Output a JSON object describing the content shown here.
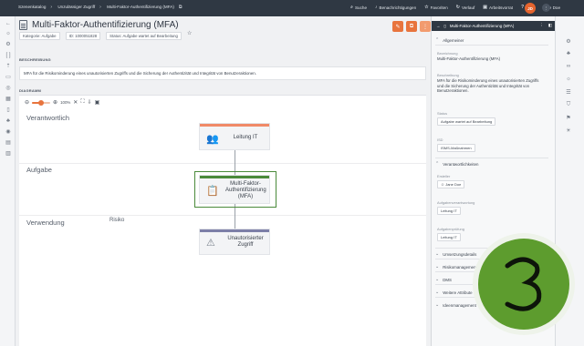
{
  "topbar": {
    "breadcrumbs": [
      "Szenenkatalog",
      "Unzulässiger Zugriff",
      "Multi-Faktor-Authentifizierung (MFA)"
    ],
    "nav": [
      {
        "icon": "search-icon",
        "glyph": "⌕",
        "label": "Suche"
      },
      {
        "icon": "bell-icon",
        "glyph": "🔔",
        "label": "Benachrichtigungen"
      },
      {
        "icon": "star-icon",
        "glyph": "☆",
        "label": "Favoriten"
      },
      {
        "icon": "history-icon",
        "glyph": "↻",
        "label": "Verlauf"
      },
      {
        "icon": "briefcase-icon",
        "glyph": "▣",
        "label": "Arbeitsvorrat"
      },
      {
        "icon": "help-icon",
        "glyph": "?",
        "label": "Hilfe"
      }
    ],
    "user_name": "Jane Doe",
    "avatar_initials": "JD"
  },
  "page": {
    "title": "Multi-Faktor-Authentifizierung (MFA)",
    "meta": [
      "Kategorie: Aufgabe",
      "ID: 1000051828",
      "Status: Aufgabe wartet auf Bearbeitung"
    ],
    "description_heading": "BESCHREIBUNG",
    "description": "MFA für die Risikominderung eines unautorisierten Zugriffs und die Sicherung der Authentizität und Integrität von Benutzeraktionen.",
    "diagram_heading": "DIAGRAMM",
    "zoom_level": "100%",
    "zoom_fraction": 0.5
  },
  "diagram": {
    "lanes": [
      "Verantwortlich",
      "Aufgabe",
      "Verwendung"
    ],
    "risk_label": "Risiko",
    "nodes": {
      "responsible": {
        "label": "Leitung IT",
        "color": "#f08a68"
      },
      "task": {
        "label": "Multi-Faktor-Authentifizierung (MFA)",
        "color": "#4a8a3a"
      },
      "usage": {
        "label": "Unautorisierter Zugriff",
        "color": "#7d7fa8"
      }
    }
  },
  "panel": {
    "title": "Multi-Faktor-Authentifizierung (MFA)",
    "sections": {
      "general": "Allgemeiner",
      "responsibilities": "Verantwortlichkeiten",
      "collapsed": [
        "Umsetzungsdetails",
        "Risikomanagement",
        "DMS",
        "Weitere Attribute",
        "Ideenmanagement"
      ]
    },
    "fields": {
      "name_label": "Bezeichnung",
      "name_value": "Multi-Faktor-Authentifizierung (MFA)",
      "desc_label": "Beschreibung",
      "desc_value": "MFA für die Risikominderung eines unautorisierten Zugriffs und die Sicherung der Authentizität und Integrität von Benutzeraktionen.",
      "status_label": "Status",
      "status_value": "Aufgabe wartet auf Bearbeitung",
      "isd_label": "ISD",
      "isd_value": "ISMS-Maßnahmen",
      "creator_label": "Ersteller",
      "creator_value": "Jane Doe",
      "responsible_label": "Aufgabenverantwortung",
      "responsible_value": "Leitung IT",
      "check_label": "Aufgabenprüfung",
      "check_value": "Leitung IT"
    }
  },
  "colors": {
    "accent": "#e8743d",
    "dark": "#2f3843",
    "logo_green": "#5d9c2e"
  }
}
